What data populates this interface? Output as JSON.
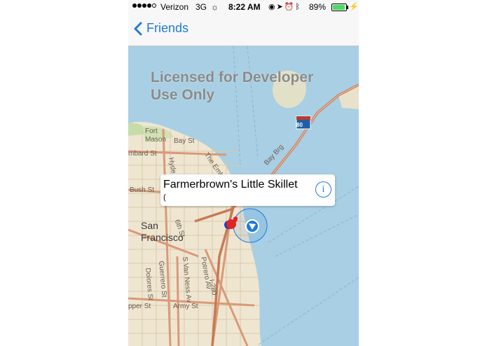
{
  "status_bar": {
    "carrier": "Verizon",
    "network": "3G",
    "time": "8:22 AM",
    "battery_percent": "89%",
    "icons": [
      "signal-dots-icon",
      "activity-spinner-icon",
      "rotation-lock-icon",
      "location-arrow-icon",
      "alarm-icon",
      "bluetooth-icon",
      "battery-icon",
      "charging-bolt-icon"
    ]
  },
  "nav": {
    "back_label": "Friends"
  },
  "map": {
    "watermark": "Licensed for Developer Use Only",
    "highway_shield": "80",
    "labels": {
      "fort_mason": "Fort\nMason",
      "bay_st": "Bay St",
      "embarcadero": "The Embarcadero",
      "bay_brg": "Bay Brg",
      "hyde_st": "Hyde St",
      "embard_st": "mbard St",
      "bush_st": "Bush St",
      "sixth_st": "6th St",
      "district": "San\nFrancisco",
      "potrero_av": "Potrero Av",
      "van_ness": "S Van Ness Av",
      "guerrero": "Guerrero St",
      "dolores": "Dolores St",
      "army_st": "Army St",
      "upper_st": "pper St",
      "i280": "I-280"
    },
    "colors": {
      "water": "#a8cfe3",
      "land": "#efe6d2",
      "highway": "#d99a78",
      "accent": "#1f7bd6"
    }
  },
  "callout": {
    "title": "Farmerbrown's Little Skillet",
    "subtitle": "("
  }
}
